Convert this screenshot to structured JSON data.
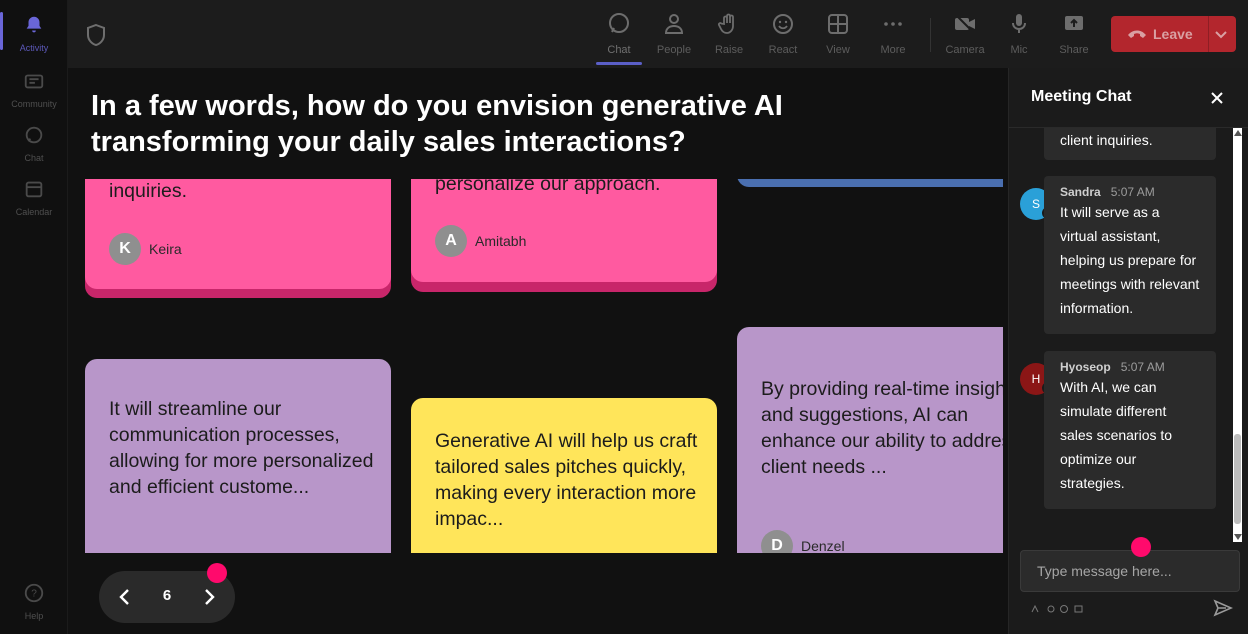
{
  "rail": {
    "items": [
      {
        "label": "Activity",
        "icon": "bell-icon",
        "active": true
      },
      {
        "label": "Community",
        "icon": "community-icon",
        "active": false
      },
      {
        "label": "Chat",
        "icon": "chat-icon",
        "active": false
      },
      {
        "label": "Calendar",
        "icon": "calendar-icon",
        "active": false
      }
    ],
    "help_label": "Help"
  },
  "toolbar": {
    "chat": "Chat",
    "people": "People",
    "raise": "Raise",
    "react": "React",
    "view": "View",
    "more": "More",
    "camera": "Camera",
    "mic": "Mic",
    "share": "Share",
    "leave": "Leave"
  },
  "stage": {
    "question": "In a few words, how do you envision generative AI transforming your daily sales interactions?",
    "cards": [
      {
        "text": "inquiries.",
        "author": "Keira",
        "initial": "K",
        "color": "#ff5aa0"
      },
      {
        "text": "personalize our approach.",
        "author": "Amitabh",
        "initial": "A",
        "color": "#ff5aa0"
      },
      {
        "text": "It will streamline our communication processes, allowing for more personalized and efficient custome...",
        "author": "",
        "initial": "",
        "color": "#b896c9"
      },
      {
        "text": "Generative AI will help us craft tailored sales pitches quickly, making every interaction more impac...",
        "author": "",
        "initial": "",
        "color": "#ffe55a"
      },
      {
        "text": "By providing real-time insights and suggestions, AI can enhance our ability to address client needs ...",
        "author": "Denzel",
        "initial": "D",
        "color": "#b896c9"
      }
    ],
    "page_number": "6"
  },
  "chat": {
    "title": "Meeting Chat",
    "messages": [
      {
        "author": "",
        "time": "",
        "text": "client inquiries."
      },
      {
        "author": "Sandra",
        "initial": "S",
        "time": "5:07 AM",
        "text": "It will serve as a virtual assistant, helping us prepare for meetings with relevant information.",
        "avatar_color": "#2aa0d8"
      },
      {
        "author": "Hyoseop",
        "initial": "H",
        "time": "5:07 AM",
        "text": "With AI, we can simulate different sales scenarios to optimize our strategies.",
        "avatar_color": "#8b1616"
      }
    ],
    "placeholder": "Type message here..."
  },
  "colors": {
    "accent": "#5b5fc7",
    "leave": "#b3262d",
    "pointer_dot": "#ff0a6c"
  }
}
